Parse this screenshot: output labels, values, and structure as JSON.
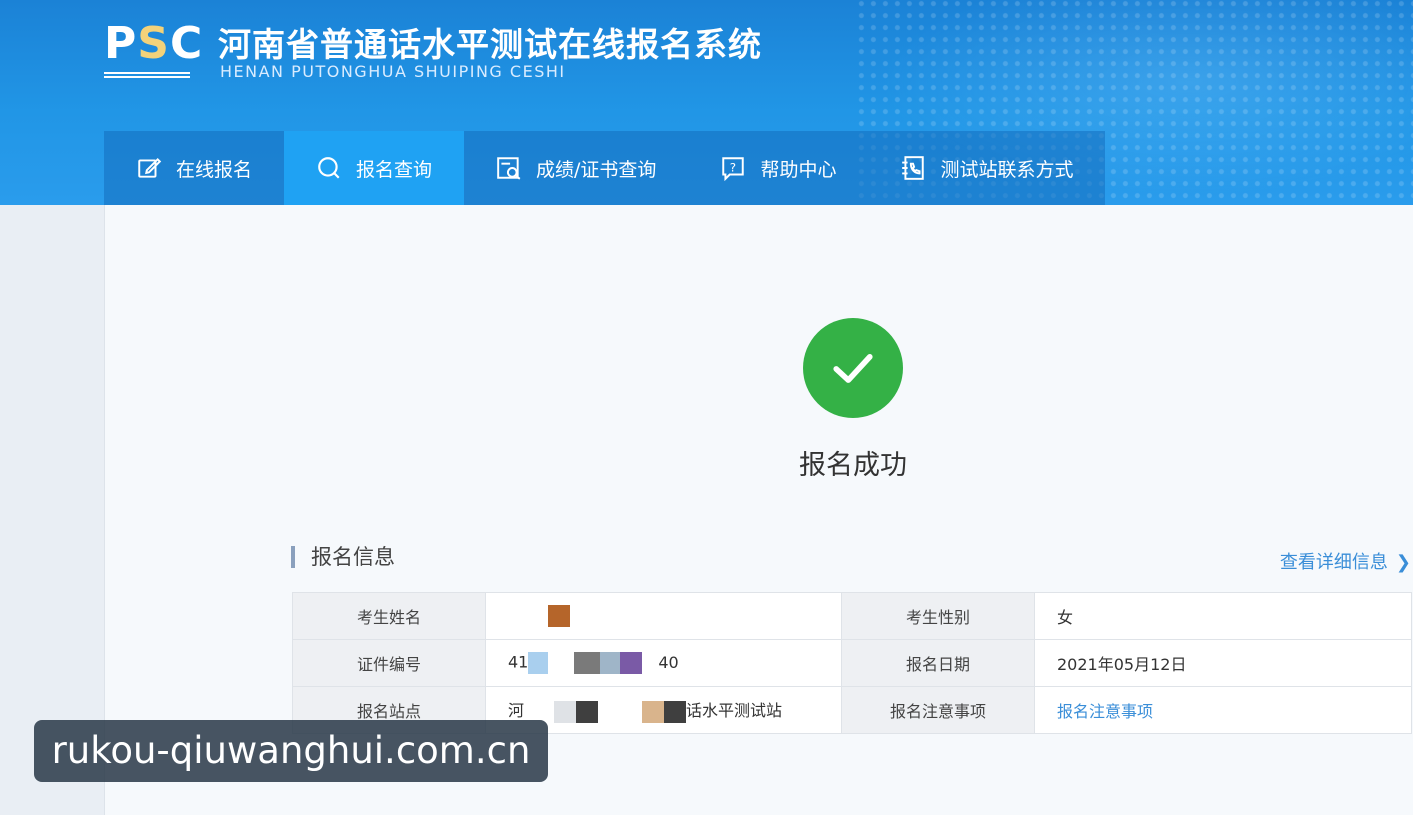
{
  "header": {
    "logo_text_p": "P",
    "logo_text_s": "S",
    "logo_text_c": "C",
    "title": "河南省普通话水平测试在线报名系统",
    "subtitle": "HENAN PUTONGHUA SHUIPING CESHI"
  },
  "nav": {
    "items": [
      {
        "label": "在线报名",
        "icon": "edit-icon",
        "active": false
      },
      {
        "label": "报名查询",
        "icon": "search-icon",
        "active": true
      },
      {
        "label": "成绩/证书查询",
        "icon": "certificate-search-icon",
        "active": false
      },
      {
        "label": "帮助中心",
        "icon": "help-icon",
        "active": false
      },
      {
        "label": "测试站联系方式",
        "icon": "contact-book-icon",
        "active": false
      }
    ]
  },
  "status": {
    "icon": "check-circle-icon",
    "text": "报名成功"
  },
  "section": {
    "title": "报名信息",
    "detail_link": "查看详细信息",
    "detail_icon": "chevron-right-icon"
  },
  "table": {
    "rows": [
      {
        "label1": "考生姓名",
        "value1": "",
        "label2": "考生性别",
        "value2": "女"
      },
      {
        "label1": "证件编号",
        "value1_prefix": "41",
        "value1_suffix": "40",
        "label2": "报名日期",
        "value2": "2021年05月12日"
      },
      {
        "label1": "报名站点",
        "value1_prefix": "河",
        "value1_suffix": "话水平测试站",
        "label2": "报名注意事项",
        "value2": "报名注意事项"
      }
    ]
  },
  "watermark": "rukou-qiuwanghui.com.cn",
  "colors": {
    "header_blue": "#1b82d6",
    "nav_active": "#1fa2f3",
    "success_green": "#34b146",
    "link_blue": "#3a8ed8"
  }
}
